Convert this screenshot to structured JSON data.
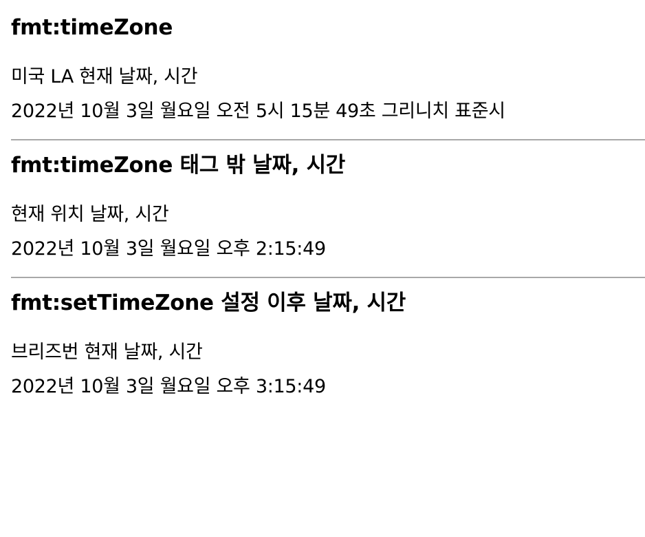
{
  "sections": [
    {
      "heading": "fmt:timeZone",
      "label": "미국 LA 현재 날짜, 시간",
      "value": "2022년 10월 3일 월요일 오전 5시 15분 49초 그리니치 표준시"
    },
    {
      "heading": "fmt:timeZone 태그 밖 날짜, 시간",
      "label": "현재 위치 날짜, 시간",
      "value": "2022년 10월 3일 월요일 오후 2:15:49"
    },
    {
      "heading": "fmt:setTimeZone 설정 이후 날짜, 시간",
      "label": "브리즈번 현재 날짜, 시간",
      "value": "2022년 10월 3일 월요일 오후 3:15:49"
    }
  ]
}
